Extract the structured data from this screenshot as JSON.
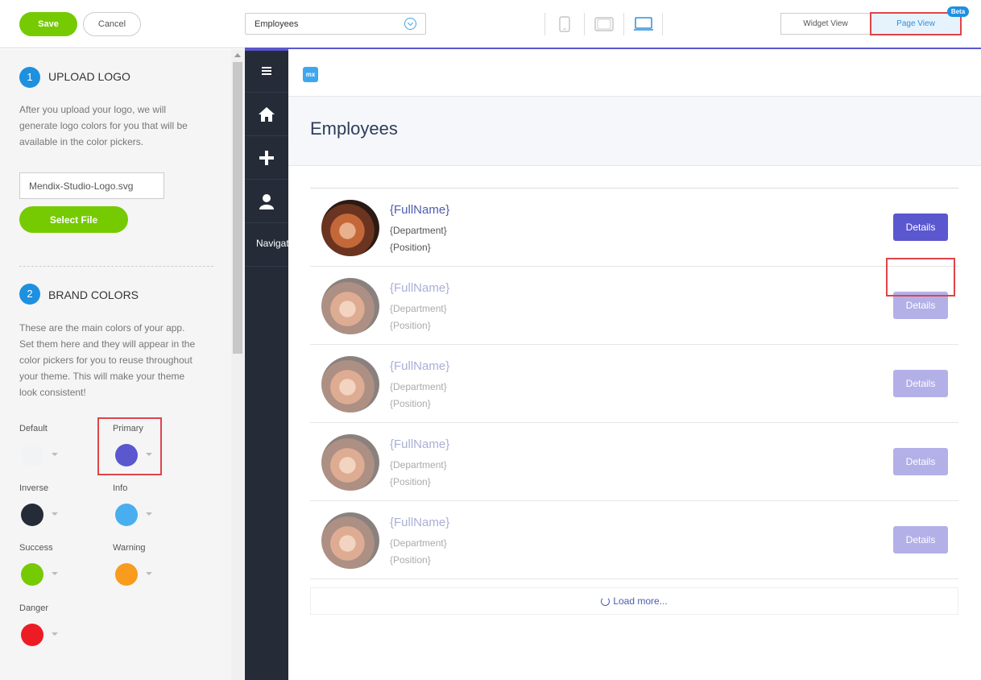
{
  "toolbar": {
    "save_label": "Save",
    "cancel_label": "Cancel",
    "page_select_value": "Employees",
    "widget_view_label": "Widget View",
    "page_view_label": "Page View",
    "beta_label": "Beta"
  },
  "left_panel": {
    "upload": {
      "step": "1",
      "title": "UPLOAD LOGO",
      "description": "After you upload your logo, we will generate logo colors for you that will be available in the color pickers.",
      "file_name": "Mendix-Studio-Logo.svg",
      "select_file_label": "Select File"
    },
    "brand": {
      "step": "2",
      "title": "BRAND COLORS",
      "description": "These are the main colors of your app. Set them here and they will appear in the color pickers for you to reuse throughout your theme. This will make your theme look consistent!",
      "colors": [
        {
          "label": "Default",
          "color": "#f2f3f5"
        },
        {
          "label": "Primary",
          "color": "#5b57ce"
        },
        {
          "label": "Inverse",
          "color": "#252c38"
        },
        {
          "label": "Info",
          "color": "#48aef0"
        },
        {
          "label": "Success",
          "color": "#76ca02"
        },
        {
          "label": "Warning",
          "color": "#f99b1d"
        },
        {
          "label": "Danger",
          "color": "#ed1c24"
        }
      ]
    }
  },
  "nav_sidebar": {
    "icons": [
      "menu-icon",
      "home-icon",
      "plus-icon",
      "user-icon"
    ],
    "navigation_label": "Navigation"
  },
  "app": {
    "logo_text": "mx",
    "page_title": "Employees",
    "employees": [
      {
        "full_name": "{FullName}",
        "department": "{Department}",
        "position": "{Position}",
        "button": "Details"
      },
      {
        "full_name": "{FullName}",
        "department": "{Department}",
        "position": "{Position}",
        "button": "Details"
      },
      {
        "full_name": "{FullName}",
        "department": "{Department}",
        "position": "{Position}",
        "button": "Details"
      },
      {
        "full_name": "{FullName}",
        "department": "{Department}",
        "position": "{Position}",
        "button": "Details"
      },
      {
        "full_name": "{FullName}",
        "department": "{Department}",
        "position": "{Position}",
        "button": "Details"
      }
    ],
    "load_more_label": "Load more..."
  },
  "colors": {
    "accent": "#5b57ce",
    "green": "#76ca02",
    "highlight": "#e0434b"
  }
}
